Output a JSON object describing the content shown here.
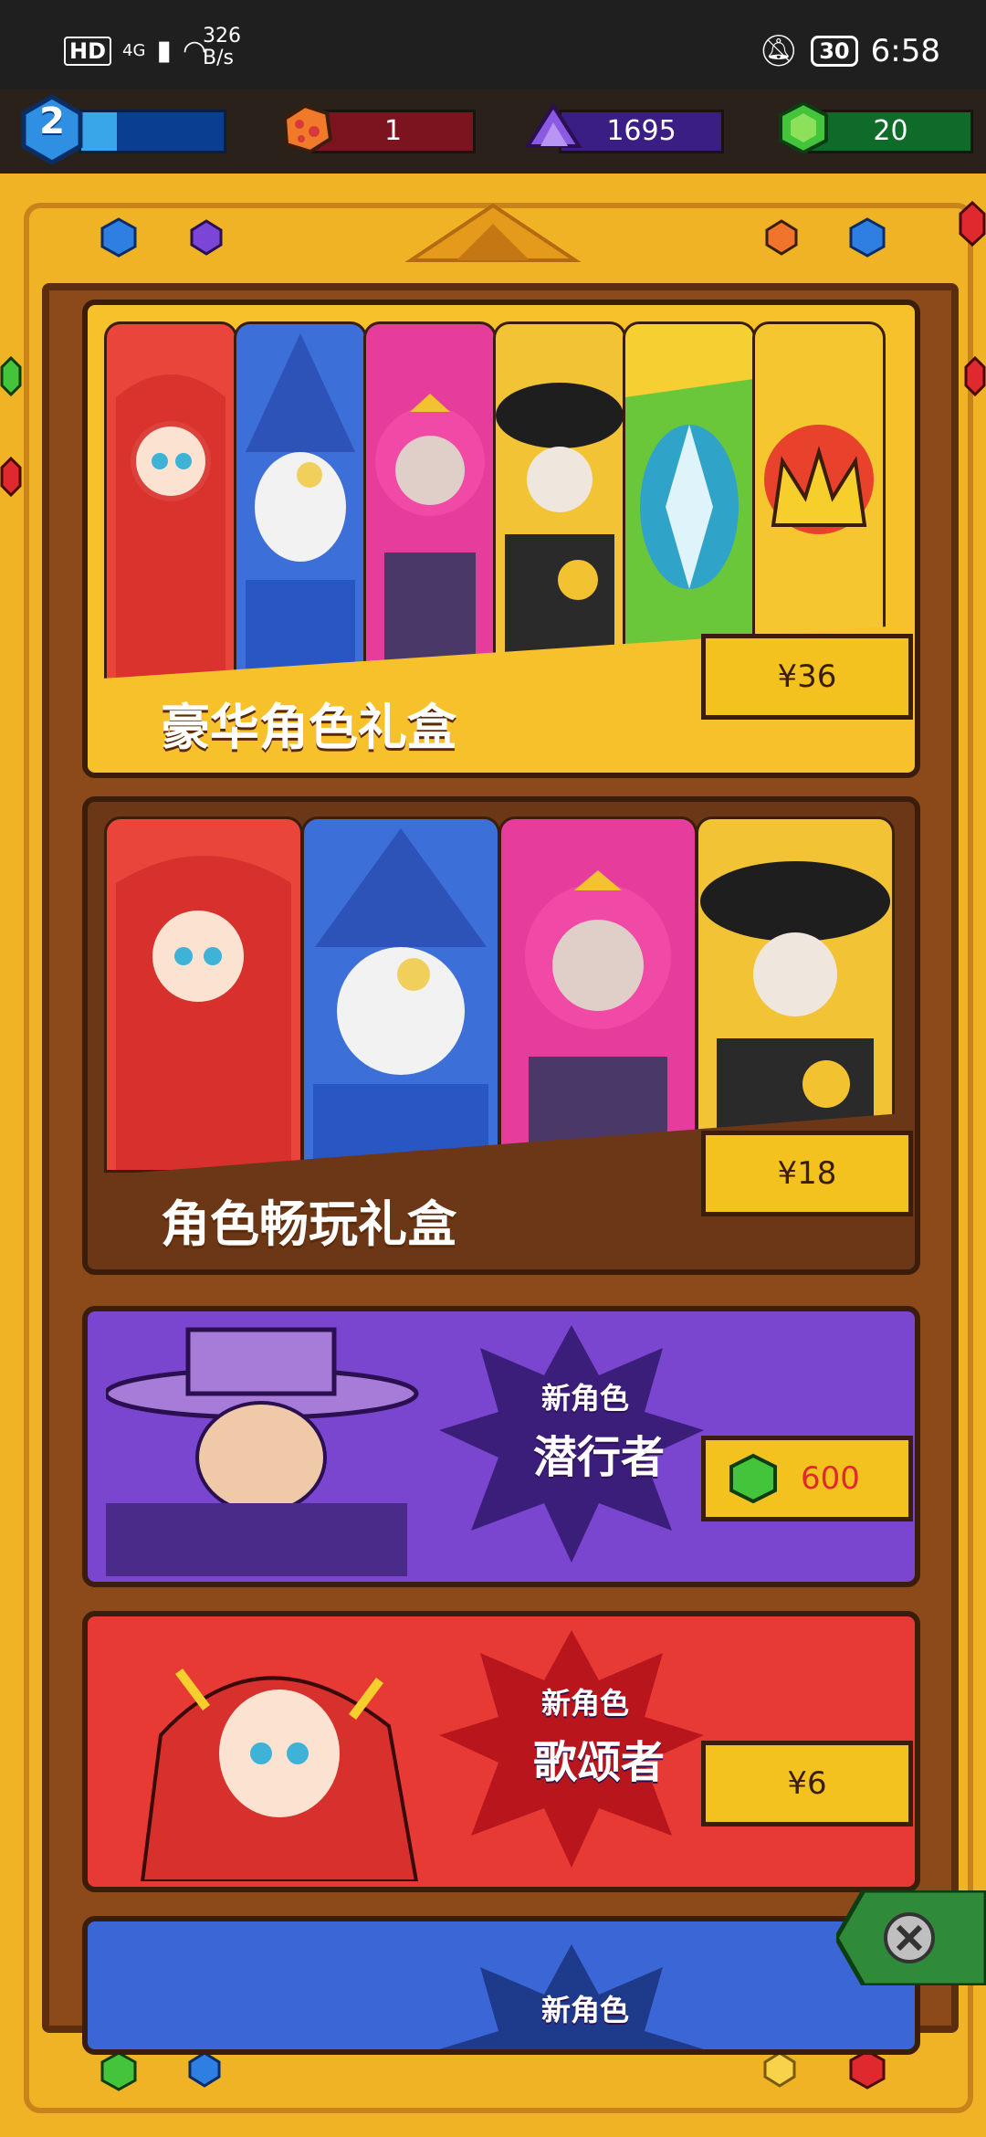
{
  "status_bar": {
    "hd": "HD",
    "network": "4G",
    "speed": "326\nB/s",
    "battery": "30",
    "time": "6:58"
  },
  "resources": {
    "level": "2",
    "xp_progress": 0.25,
    "red_crystal": "1",
    "purple_crystal": "1695",
    "green_gem": "20"
  },
  "offers": [
    {
      "title": "豪华角色礼盒",
      "price": "¥36"
    },
    {
      "title": "角色畅玩礼盒",
      "price": "¥18"
    },
    {
      "badge": "新角色",
      "name": "潜行者",
      "price": "600"
    },
    {
      "badge": "新角色",
      "name": "歌颂者",
      "price": "¥6"
    },
    {
      "badge": "新角色"
    }
  ],
  "colors": {
    "frame": "#f0b325",
    "price_tag": "#f4c21e",
    "card_purple": "#7a45cf",
    "card_red": "#e83a35",
    "card_blue": "#3b67d6"
  },
  "icons": [
    "level-hex-icon",
    "red-crystal-icon",
    "purple-crystal-icon",
    "green-gem-icon",
    "close-icon"
  ]
}
